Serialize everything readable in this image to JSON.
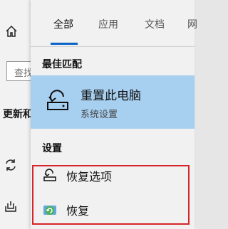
{
  "background_window": {
    "search_text": "查找",
    "heading_text": "更新和"
  },
  "tabs": [
    {
      "label": "全部",
      "active": true
    },
    {
      "label": "应用",
      "active": false
    },
    {
      "label": "文档",
      "active": false
    },
    {
      "label": "网",
      "active": false
    }
  ],
  "best_match": {
    "section_title": "最佳匹配",
    "title": "重置此电脑",
    "subtitle": "系统设置",
    "icon": "reset-pc-icon"
  },
  "settings": {
    "section_title": "设置",
    "items": [
      {
        "label": "恢复选项",
        "icon": "recovery-options-icon"
      },
      {
        "label": "恢复",
        "icon": "recovery-green-icon"
      }
    ]
  },
  "colors": {
    "accent": "#0a64c6",
    "selected_bg": "#a7cff0",
    "highlight_box": "#d6252a"
  }
}
